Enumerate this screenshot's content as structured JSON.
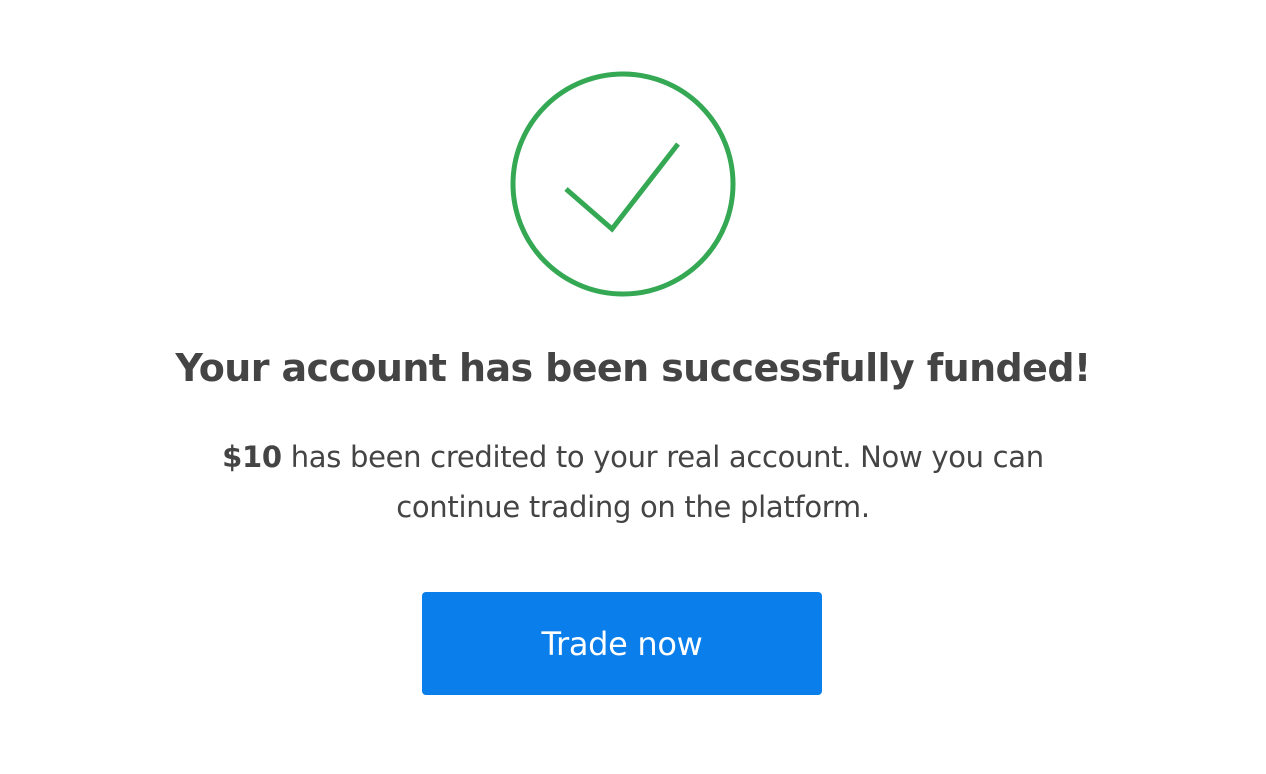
{
  "status": {
    "icon": "checkmark-circle-icon",
    "color": "#34a853"
  },
  "title": "Your account has been successfully funded!",
  "message": {
    "amount": "$10",
    "text": " has been credited to your real account. Now you can continue trading on the platform."
  },
  "button": {
    "label": "Trade now",
    "color": "#0a7eea"
  }
}
